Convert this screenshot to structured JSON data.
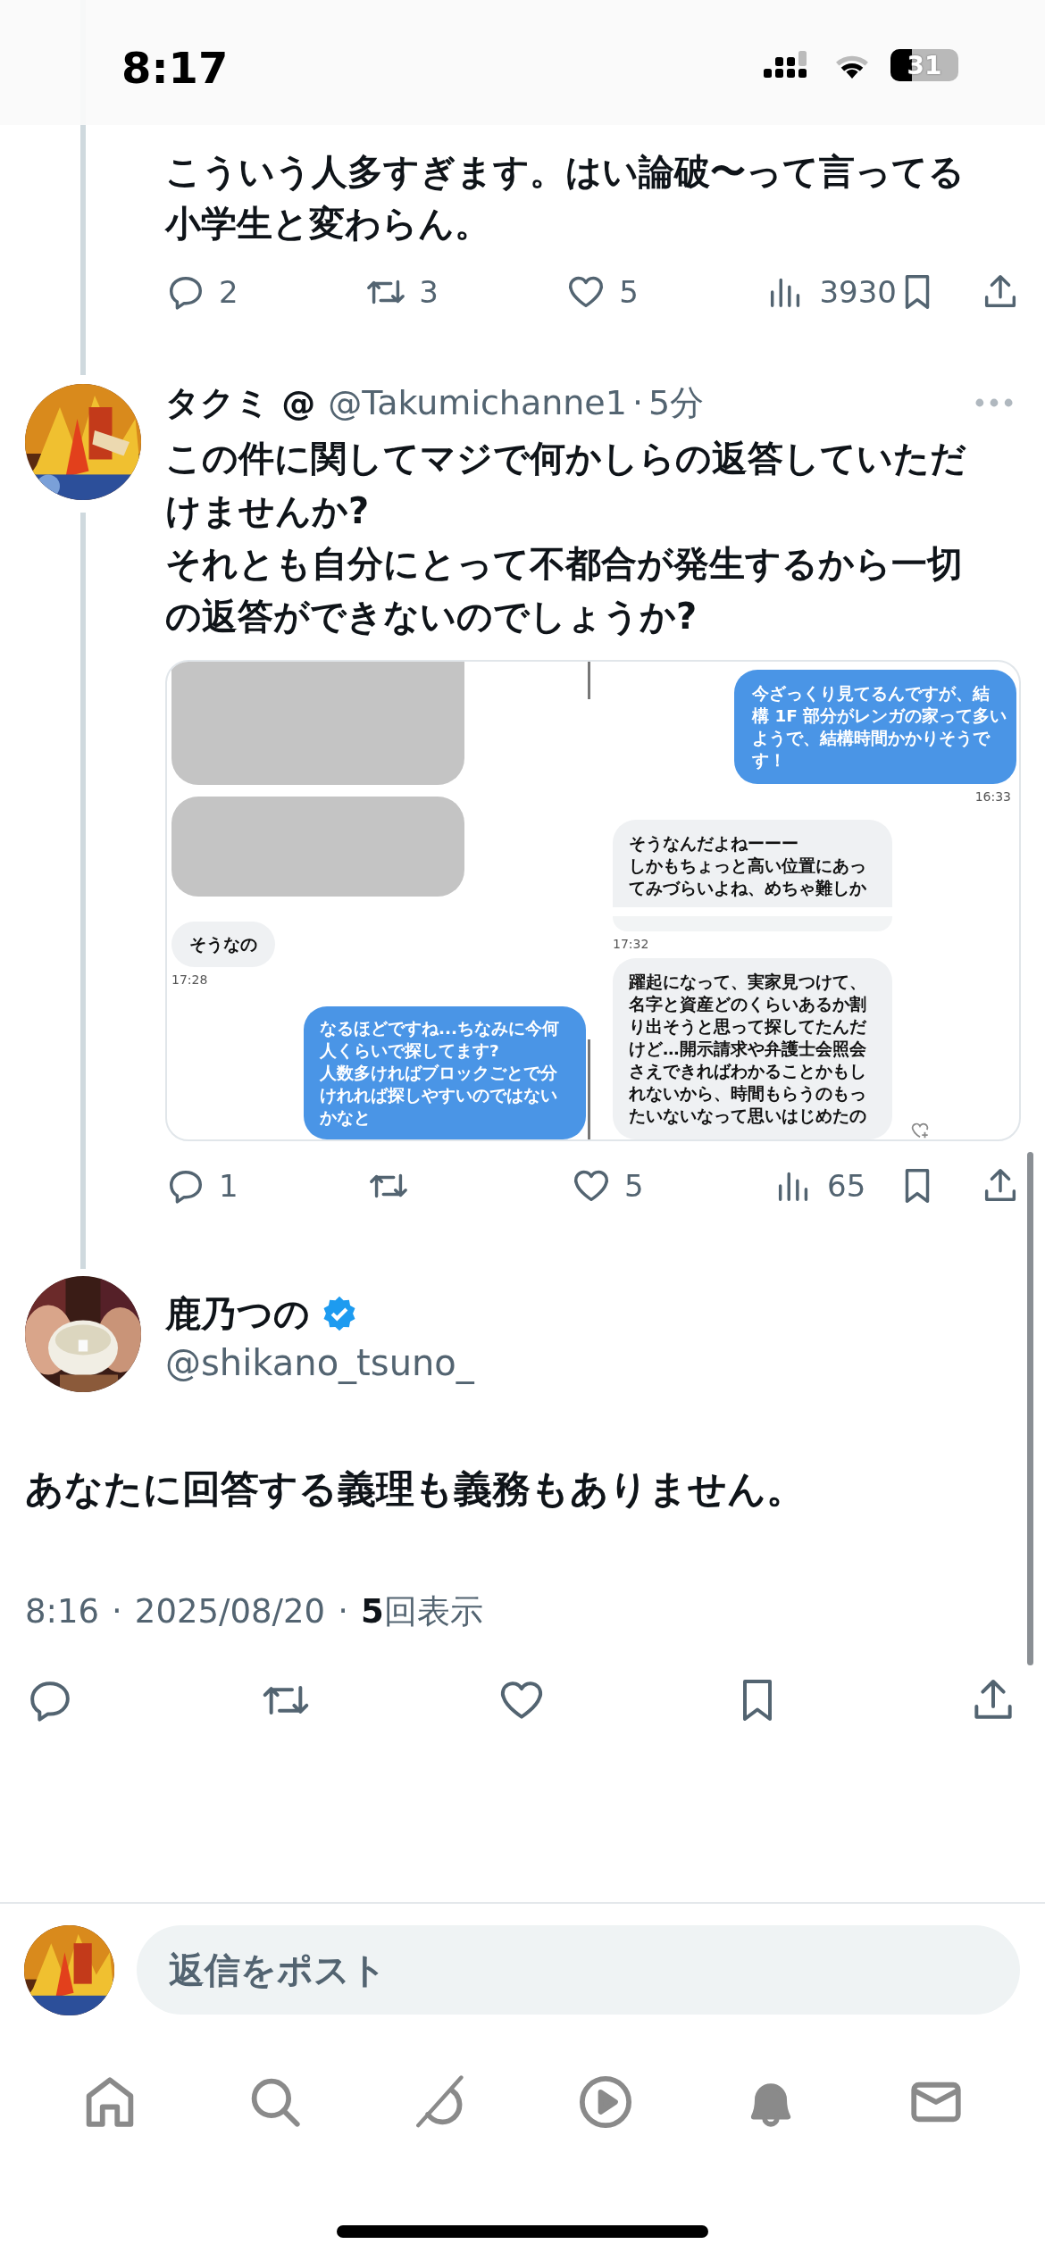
{
  "status_bar": {
    "time": "8:17",
    "battery": "31"
  },
  "thread": [
    {
      "kind": "tail",
      "lines": [
        "こういう人多すぎます。はい論破〜って言ってる",
        "小学生と変わらん。"
      ],
      "actions": {
        "replies": "2",
        "reposts": "3",
        "likes": "5",
        "views": "3930"
      }
    },
    {
      "kind": "reply",
      "name": "タクミ @",
      "handle": "@Takumichanne1",
      "separator": "·",
      "time": "5分",
      "lines": [
        "この件に関してマジで何かしらの返答していただ",
        "けませんか?",
        "それとも自分にとって不都合が発生するから一切",
        "の返答ができないのでしょうか?"
      ],
      "attachment": {
        "left": [
          {
            "kind": "redacted"
          },
          {
            "kind": "redacted"
          },
          {
            "kind": "received",
            "lines": [
              "そうなの"
            ]
          },
          {
            "kind": "time",
            "text": "17:28"
          },
          {
            "kind": "sent",
            "lines": [
              "なるほどですね...ちなみに今何",
              "人くらいで探してます?",
              "人数多ければブロックごとで分",
              "けれれば探しやすいのではない",
              "かなと"
            ]
          }
        ],
        "right": [
          {
            "kind": "sent",
            "lines": [
              "今ざっくり見てるんですが、結",
              "構 1F 部分がレンガの家って多い",
              "ようで、結構時間かかりそうで",
              "す！"
            ]
          },
          {
            "kind": "time",
            "text": "16:33"
          },
          {
            "kind": "received",
            "clipped": true,
            "lines": [
              "そうなんだよねーーー",
              "しかもちょっと高い位置にあっ",
              "てみづらいよね、めちゃ難しか"
            ]
          },
          {
            "kind": "faded"
          },
          {
            "kind": "time",
            "text": "17:32"
          },
          {
            "kind": "received",
            "lines": [
              "躍起になって、実家見つけて、",
              "名字と資産どのくらいあるか割",
              "り出そうと思って探してたんだ",
              "けど…開示請求や弁護士会照会",
              "さえできればわかることかもし",
              "れないから、時間もらうのもっ",
              "たいないなって思いはじめたの"
            ]
          }
        ]
      },
      "actions": {
        "replies": "1",
        "likes": "5",
        "views": "65"
      }
    }
  ],
  "main_post": {
    "name": "鹿乃つの",
    "verified": true,
    "handle": "@shikano_tsuno_",
    "text": "あなたに回答する義理も義務もありません。",
    "time": "8:16",
    "separator": "·",
    "date": "2025/08/20",
    "view_count": "5",
    "view_label": "回表示"
  },
  "reply_bar": {
    "placeholder": "返信をポスト"
  },
  "nav": [
    {
      "kind": "home"
    },
    {
      "kind": "search"
    },
    {
      "kind": "grok"
    },
    {
      "kind": "video"
    },
    {
      "kind": "notifications"
    },
    {
      "kind": "messages"
    }
  ]
}
